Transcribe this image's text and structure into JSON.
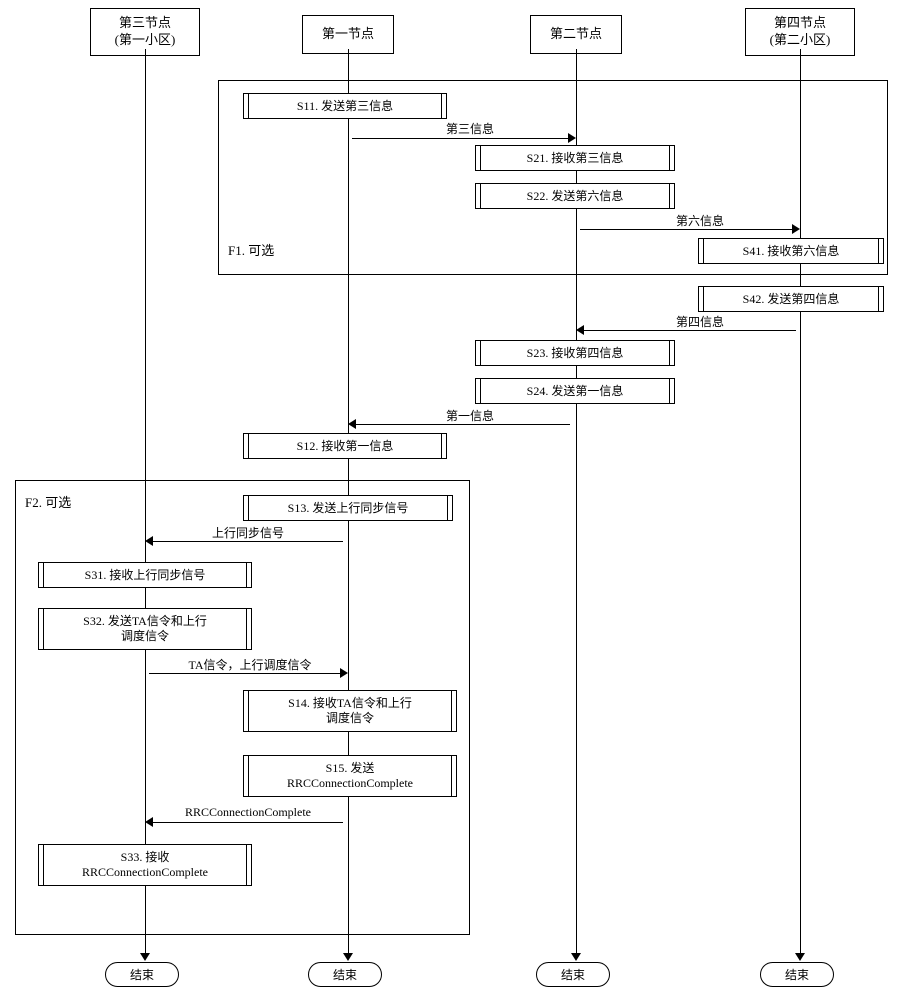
{
  "participants": {
    "p1": "第三节点\n(第一小区)",
    "p2": "第一节点",
    "p3": "第二节点",
    "p4": "第四节点\n(第二小区)"
  },
  "frames": {
    "f1": "F1.  可选",
    "f2": "F2.  可选"
  },
  "steps": {
    "s11": "S11. 发送第三信息",
    "s21": "S21. 接收第三信息",
    "s22": "S22. 发送第六信息",
    "s41": "S41. 接收第六信息",
    "s42": "S42. 发送第四信息",
    "s23": "S23. 接收第四信息",
    "s24": "S24. 发送第一信息",
    "s12": "S12. 接收第一信息",
    "s13": "S13. 发送上行同步信号",
    "s31": "S31. 接收上行同步信号",
    "s32": "S32. 发送TA信令和上行\n调度信令",
    "s14": "S14. 接收TA信令和上行\n调度信令",
    "s15": "S15. 发送\nRRCConnectionComplete",
    "s33": "S33. 接收\nRRCConnectionComplete"
  },
  "messages": {
    "m3": "第三信息",
    "m6": "第六信息",
    "m4": "第四信息",
    "m1": "第一信息",
    "uplink": "上行同步信号",
    "ta": "TA信令，上行调度信令",
    "rrc": "RRCConnectionComplete"
  },
  "terminator": "结束"
}
